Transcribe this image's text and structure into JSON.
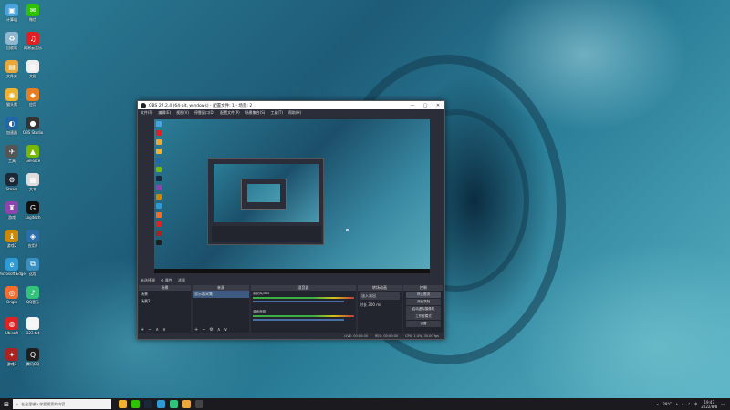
{
  "desktop": {
    "icons": [
      {
        "label": "计算机",
        "color": "#4aa3df",
        "glyph": "▣"
      },
      {
        "label": "微信",
        "color": "#2dc100",
        "glyph": "✉"
      },
      {
        "label": "回收站",
        "color": "#8fb8d0",
        "glyph": "♻"
      },
      {
        "label": "网易云音乐",
        "color": "#e02020",
        "glyph": "♫"
      },
      {
        "label": "文件夹",
        "color": "#e8a93a",
        "glyph": "▤"
      },
      {
        "label": "文档",
        "color": "#eeeeee",
        "glyph": "▥"
      },
      {
        "label": "猫头鹰",
        "color": "#f0b030",
        "glyph": "◉"
      },
      {
        "label": "应用",
        "color": "#e67e22",
        "glyph": "◆"
      },
      {
        "label": "加速器",
        "color": "#2266aa",
        "glyph": "◐"
      },
      {
        "label": "OBS Studio",
        "color": "#333333",
        "glyph": "●"
      },
      {
        "label": "工具",
        "color": "#555555",
        "glyph": "✈"
      },
      {
        "label": "GeForce",
        "color": "#76b900",
        "glyph": "▲"
      },
      {
        "label": "Steam",
        "color": "#1b2838",
        "glyph": "⚙"
      },
      {
        "label": "文本",
        "color": "#dddddd",
        "glyph": "▦"
      },
      {
        "label": "游戏",
        "color": "#8e44ad",
        "glyph": "♜"
      },
      {
        "label": "Logitech",
        "color": "#111111",
        "glyph": "G"
      },
      {
        "label": "游戏2",
        "color": "#cc8800",
        "glyph": "♝"
      },
      {
        "label": "应用2",
        "color": "#2d6ea8",
        "glyph": "◈"
      },
      {
        "label": "Microsoft Edge",
        "color": "#2e9bd6",
        "glyph": "e"
      },
      {
        "label": "远程",
        "color": "#3a8fc0",
        "glyph": "⧉"
      },
      {
        "label": "Origin",
        "color": "#f56c2d",
        "glyph": "◎"
      },
      {
        "label": "QQ音乐",
        "color": "#31c27c",
        "glyph": "♪"
      },
      {
        "label": "Ubisoft",
        "color": "#dd2222",
        "glyph": "◍"
      },
      {
        "label": "123.txt",
        "color": "#f5f5f5",
        "glyph": "▭"
      },
      {
        "label": "游戏3",
        "color": "#aa2222",
        "glyph": "✦"
      },
      {
        "label": "腾讯QQ",
        "color": "#1e1e1e",
        "glyph": "Q"
      }
    ]
  },
  "obs": {
    "title": "OBS 27.2.4 (64-bit, windows) - 配置文件: 1 - 场景: 2",
    "menu": [
      "文件(F)",
      "编辑(E)",
      "视图(V)",
      "停靠窗口(D)",
      "配置文件(P)",
      "场景集合(S)",
      "工具(T)",
      "帮助(H)"
    ],
    "no_source": "未选择源",
    "source_toolbar": [
      "⚙ 属性",
      "滤镜"
    ],
    "scenes": {
      "header": "场景",
      "items": [
        "场景",
        "场景2"
      ]
    },
    "sources": {
      "header": "来源",
      "items": [
        "显示器采集"
      ]
    },
    "mixer": {
      "header": "混音器",
      "channels": [
        {
          "name": "麦克风/Aux",
          "db": "0.0 dB"
        },
        {
          "name": "桌面音频",
          "db": "0.0 dB"
        }
      ]
    },
    "transitions": {
      "header": "转场动画",
      "type": "淡入淡出",
      "duration_label": "时长",
      "duration": "300 ms"
    },
    "controls": {
      "header": "控制",
      "buttons": [
        "停止推流",
        "开始录制",
        "启动虚拟摄像机",
        "工作室模式",
        "设置",
        "退出"
      ]
    },
    "status": [
      "LIVE: 00:00:00",
      "REC: 00:00:00",
      "CPU: 1.4%, 30.00 fps"
    ],
    "window_buttons": [
      "—",
      "▢",
      "✕"
    ]
  },
  "taskbar": {
    "search_placeholder": "在这里输入你要搜索的内容",
    "apps": [
      "#f0b030",
      "#2dc100",
      "#1b2838",
      "#2e9bd6",
      "#31c27c",
      "#e8a93a",
      "#444444"
    ],
    "weather": "28°C",
    "ime": "中",
    "time": "19:47",
    "date": "2022/8/8"
  }
}
